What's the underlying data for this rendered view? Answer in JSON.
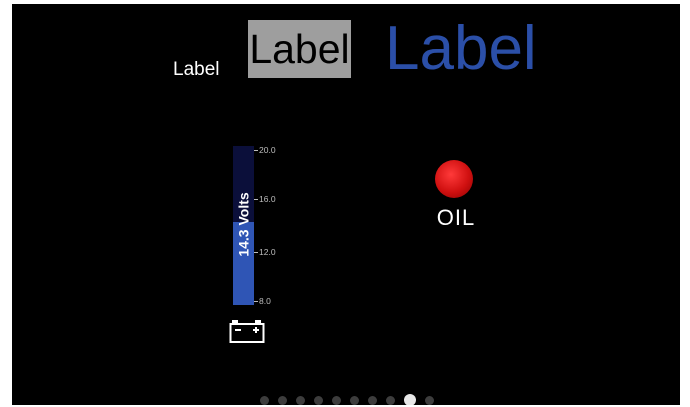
{
  "labels": {
    "small": "Label",
    "boxed": "Label",
    "large": "Label"
  },
  "voltmeter": {
    "text": "14.3 Volts",
    "value": 14.3,
    "min": 8.0,
    "max": 20.0,
    "ticks": [
      "20.0",
      "16.0",
      "12.0",
      "8.0"
    ],
    "icon": "battery-icon",
    "fill_color": "#2f55b5",
    "track_color": "#0b0f3a"
  },
  "warning": {
    "label": "OIL",
    "icon": "oil-warning-light",
    "color": "#d01010"
  },
  "pager": {
    "total": 10,
    "active_index": 8
  },
  "colors": {
    "background": "#000000",
    "accent": "#2b4fa8",
    "label_box": "#9e9e9e"
  }
}
